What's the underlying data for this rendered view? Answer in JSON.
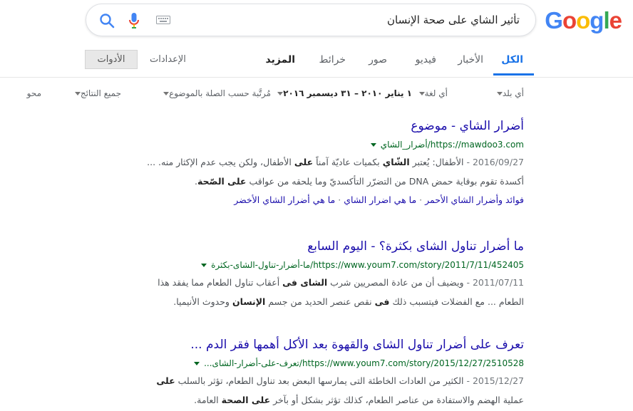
{
  "logo": {
    "letters": [
      "G",
      "o",
      "o",
      "g",
      "l",
      "e"
    ],
    "colors": [
      "#4285f4",
      "#ea4335",
      "#fbbc05",
      "#4285f4",
      "#34a853",
      "#ea4335"
    ]
  },
  "search": {
    "value": "تأثير الشاي على صحة الإنسان"
  },
  "tabs": {
    "all": "الكل",
    "news": "الأخبار",
    "videos": "فيديو",
    "images": "صور",
    "maps": "خرائط",
    "more": "المزيد",
    "settings": "الإعدادات",
    "tools": "الأدوات"
  },
  "filters": {
    "country": "أي بلد",
    "language": "أي لغة",
    "date": "١ يناير ٢٠١٠ – ٣١ ديسمبر ٢٠١٦",
    "sort": "مُرتَّبة حسب الصلة بالموضوع",
    "results": "جميع النتائج",
    "clear": "محو"
  },
  "results": [
    {
      "title": "أضرار الشاي - موضوع",
      "url": "https://mawdoo3.com/أضرار_الشاي",
      "snippet_1_date": "2016/09/27 -",
      "snippet_1a": " الأطفال: يُعتبر ",
      "snippet_1_b1": "الشّاي",
      "snippet_1b": " بكميات عاديّة آمناً ",
      "snippet_1_b2": "على",
      "snippet_1c": " الأطفال، ولكن يجب عدم الإكثار منه. ...",
      "snippet_2a": "أكسدة تقوم بوقاية حمض DNA من التضرّر التأكسديّ وما يلحقه من عواقب ",
      "snippet_2_b1": "على الصّحة",
      "snippet_2b": ".",
      "sitelinks": [
        "فوائد وأضرار الشاي الأحمر",
        "ما هي اضرار الشاي",
        "ما هي أضرار الشاي الأخضر"
      ],
      "sep": "·"
    },
    {
      "title": "ما أضرار تناول الشاى بكثرة؟ - اليوم السابع",
      "url": "https://www.youm7.com/story/2011/7/11/452405/ما-أضرار-تناول-الشاى-بكثرة",
      "snippet_1_date": "2011/07/11 -",
      "snippet_1a": " ويضيف أن من عادة المصريين شرب ",
      "snippet_1_b1": "الشاى فى",
      "snippet_1b": " أعقاب تناول الطعام مما يفقد هذا",
      "snippet_2a": "الطعام ... مع الفضلات فيتسبب ذلك ",
      "snippet_2_b1": "فى",
      "snippet_2b": " نقص عنصر الحديد من جسم ",
      "snippet_2_b2": "الإنسان",
      "snippet_2c": " وحدوث الأنيميا."
    },
    {
      "title": "تعرف على أضرار تناول الشاى والقهوة بعد الأكل أهمها فقر الدم ...",
      "url": "https://www.youm7.com/story/2015/12/27/2510528/تعرف-على-أضرار-الشاى...",
      "snippet_1_date": "2015/12/27 -",
      "snippet_1a": " الكثير من العادات الخاطئة التى يمارسها البعض بعد تناول الطعام، تؤثر بالسلب ",
      "snippet_1_b1": "على",
      "snippet_2a": "عملية الهضم والاستفادة من عناصر الطعام، كذلك تؤثر بشكل أو بآخر ",
      "snippet_2_b1": "على الصحة",
      "snippet_2b": " العامة."
    }
  ]
}
